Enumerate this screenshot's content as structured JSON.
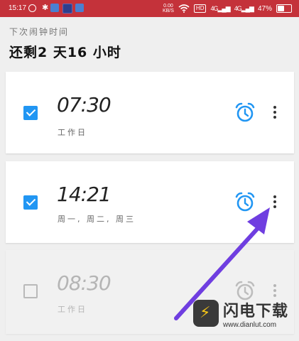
{
  "status_bar": {
    "time": "15:17",
    "net_speed_value": "0.00",
    "net_speed_unit": "KB/S",
    "hd_label": "HD",
    "signal_1": "4G",
    "signal_2": "4G",
    "battery_text": "47%",
    "battery_level": 0.47
  },
  "header": {
    "label": "下次闹钟时间",
    "remaining": "还剩2 天16 小时"
  },
  "alarms": [
    {
      "time": "07:30",
      "days": "工作日",
      "enabled": true
    },
    {
      "time": "14:21",
      "days": "周一, 周二, 周三",
      "enabled": true
    },
    {
      "time": "08:30",
      "days": "工作日",
      "enabled": false
    }
  ],
  "colors": {
    "status_bar": "#c4323a",
    "accent": "#2196f3",
    "arrow": "#6f3ee0"
  },
  "watermark": {
    "title": "闪电下载",
    "url": "www.dianlut.com"
  }
}
